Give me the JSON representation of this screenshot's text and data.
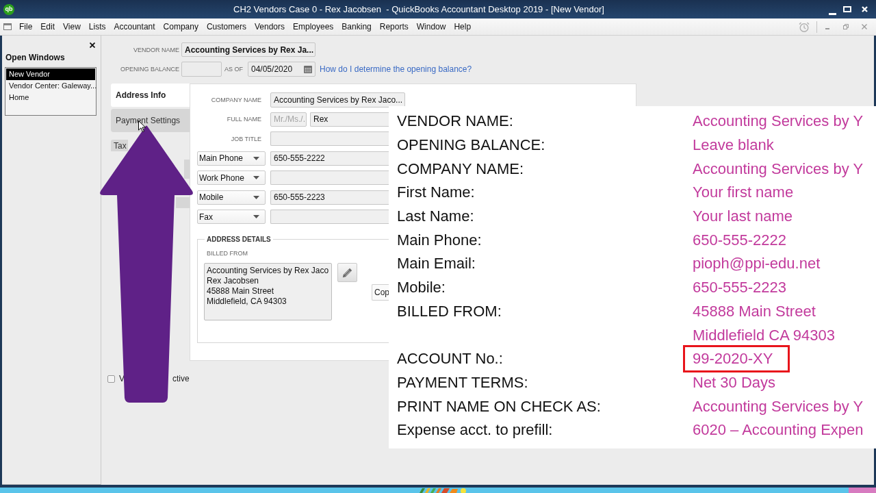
{
  "window": {
    "logo": "qb",
    "title": "CH2 Vendors Case 0 - Rex Jacobsen  - QuickBooks Accountant Desktop 2019 - [New Vendor]"
  },
  "menu": [
    "File",
    "Edit",
    "View",
    "Lists",
    "Accountant",
    "Company",
    "Customers",
    "Vendors",
    "Employees",
    "Banking",
    "Reports",
    "Window",
    "Help"
  ],
  "open_windows": {
    "title": "Open Windows",
    "items": [
      {
        "label": "New Vendor",
        "selected": true
      },
      {
        "label": "Vendor Center: Galeway...",
        "selected": false
      },
      {
        "label": "Home",
        "selected": false
      }
    ]
  },
  "vendor_form": {
    "vendor_name": {
      "label": "VENDOR NAME",
      "value": "Accounting Services by Rex Ja..."
    },
    "opening_balance": {
      "label": "OPENING BALANCE"
    },
    "as_of": {
      "label": "AS OF",
      "value": "04/05/2020"
    },
    "help_link": "How do I determine the opening balance?",
    "tabs": [
      {
        "label": "Address Info",
        "selected": true
      },
      {
        "label": "Payment Settings",
        "selected": false
      },
      {
        "label": "Tax",
        "selected": false
      },
      {
        "selected": false
      },
      {
        "selected": false
      }
    ],
    "company_name": {
      "label": "COMPANY NAME",
      "value": "Accounting Services by Rex Jaco..."
    },
    "full_name": {
      "label": "FULL NAME",
      "title": {
        "placeholder": "Mr./Ms./.."
      },
      "first_name": {
        "value": "Rex"
      }
    },
    "job_title": {
      "label": "JOB TITLE"
    },
    "phones": [
      {
        "type": "Main Phone",
        "value": "650-555-2222"
      },
      {
        "type": "Work Phone"
      },
      {
        "type": "Mobile",
        "value": "650-555-2223"
      },
      {
        "type": "Fax"
      }
    ],
    "address_details": {
      "title": "ADDRESS DETAILS",
      "billed_from_label": "BILLED FROM",
      "billed_from_lines": [
        "Accounting Services by Rex Jaco",
        "Rex Jacobsen",
        "45888 Main Street",
        "Middlefield, CA 94303"
      ],
      "copy_button": "Cop"
    },
    "inactive_checkbox": {
      "checked": false,
      "label_start": "V",
      "label_end": "ctive"
    }
  },
  "instructions": {
    "rows": [
      {
        "label": "VENDOR NAME:",
        "value": "Accounting Services by Y",
        "highlighted": false
      },
      {
        "label": "OPENING BALANCE:",
        "value": "Leave blank",
        "highlighted": false
      },
      {
        "label": "COMPANY NAME:",
        "value": "Accounting Services by Y",
        "highlighted": false
      },
      {
        "label": "First Name:",
        "value": "Your first name",
        "highlighted": false
      },
      {
        "label": "Last Name:",
        "value": "Your last name",
        "highlighted": false
      },
      {
        "label": "Main Phone:",
        "value": "650-555-2222",
        "highlighted": false
      },
      {
        "label": "Main Email:",
        "value": "pioph@ppi-edu.net",
        "highlighted": false
      },
      {
        "label": "Mobile:",
        "value": "650-555-2223",
        "highlighted": false
      },
      {
        "label": "BILLED FROM:",
        "value": "45888 Main Street",
        "highlighted": false
      },
      {
        "value": "Middlefield CA 94303",
        "highlighted": false
      },
      {
        "label": "ACCOUNT No.:",
        "value": "99-2020-XY",
        "highlighted": true
      },
      {
        "label": "PAYMENT TERMS:",
        "value": "Net 30 Days",
        "highlighted": false
      },
      {
        "label": "PRINT NAME ON CHECK AS:",
        "value": "Accounting Services by Y",
        "highlighted": false
      },
      {
        "label": "Expense acct. to prefill:",
        "value": "6020 – Accounting Expen",
        "highlighted": false
      }
    ]
  }
}
